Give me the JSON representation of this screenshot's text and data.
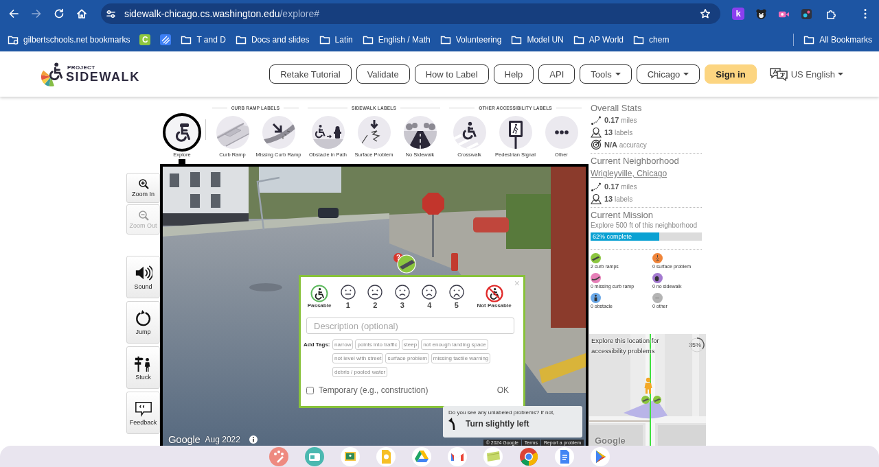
{
  "browser": {
    "forward_disabled": true,
    "url": {
      "host": "sidewalk-chicago.cs.washington.edu",
      "path": "/explore#"
    },
    "extensions": [
      {
        "kind": "letter",
        "label": "k"
      },
      {
        "kind": "bear"
      },
      {
        "kind": "camera"
      },
      {
        "kind": "dots"
      },
      {
        "kind": "puzzle"
      }
    ]
  },
  "bookmarks": {
    "items": [
      {
        "kind": "managed-folder",
        "label": "gilbertschools.net bookmarks"
      },
      {
        "kind": "letter",
        "label": "C"
      },
      {
        "kind": "stripes"
      },
      {
        "kind": "folder",
        "label": "T and D"
      },
      {
        "kind": "folder",
        "label": "Docs and slides"
      },
      {
        "kind": "folder",
        "label": "Latin"
      },
      {
        "kind": "folder",
        "label": "English / Math"
      },
      {
        "kind": "folder",
        "label": "Volunteering"
      },
      {
        "kind": "folder",
        "label": "Model UN"
      },
      {
        "kind": "folder",
        "label": "AP World"
      },
      {
        "kind": "folder",
        "label": "chem"
      }
    ],
    "all": "All Bookmarks"
  },
  "header": {
    "logo": {
      "small": "PROJECT",
      "big": "SIDEWALK"
    },
    "nav": [
      {
        "label": "Retake Tutorial",
        "kind": "outline"
      },
      {
        "label": "Validate",
        "kind": "outline"
      },
      {
        "label": "How to Label",
        "kind": "outline"
      },
      {
        "label": "Help",
        "kind": "outline"
      },
      {
        "label": "API",
        "kind": "outline"
      },
      {
        "label": "Tools",
        "kind": "dropdown"
      },
      {
        "label": "Chicago",
        "kind": "dropdown"
      },
      {
        "label": "Sign in",
        "kind": "primary"
      }
    ],
    "language": "US English"
  },
  "label_toolbar": {
    "explore": {
      "label": "Explore",
      "selected": true
    },
    "groups": [
      {
        "heading": "CURB RAMP LABELS",
        "tools": [
          {
            "kind": "curb-ramp",
            "label": "Curb Ramp",
            "selected": false
          },
          {
            "kind": "missing-curb-ramp",
            "label": "Missing Curb Ramp",
            "selected": false
          }
        ]
      },
      {
        "heading": "SIDEWALK LABELS",
        "tools": [
          {
            "kind": "obstacle",
            "label": "Obstacle in Path",
            "selected": false
          },
          {
            "kind": "surface-problem",
            "label": "Surface Problem",
            "selected": false
          },
          {
            "kind": "no-sidewalk",
            "label": "No Sidewalk",
            "selected": false
          }
        ]
      },
      {
        "heading": "OTHER ACCESSIBILITY LABELS",
        "tools": [
          {
            "kind": "crosswalk",
            "label": "Crosswalk",
            "selected": false
          },
          {
            "kind": "pedestrian-signal",
            "label": "Pedestrian Signal",
            "selected": false
          },
          {
            "kind": "other",
            "label": "Other",
            "selected": false
          }
        ]
      }
    ]
  },
  "left_tools": {
    "zoom": [
      {
        "kind": "zoom-in",
        "label": "Zoom In",
        "disabled": false
      },
      {
        "kind": "zoom-out",
        "label": "Zoom Out",
        "disabled": true
      }
    ],
    "actions": [
      {
        "kind": "sound",
        "label": "Sound"
      },
      {
        "kind": "jump",
        "label": "Jump"
      },
      {
        "kind": "stuck",
        "label": "Stuck"
      },
      {
        "kind": "feedback",
        "label": "Feedback"
      }
    ]
  },
  "street_view": {
    "logo": "Google",
    "date": "Aug 2022",
    "marker": {
      "symbol": "?"
    },
    "popup": {
      "close": "×",
      "severity": [
        {
          "kind": "passable",
          "label": "Passable",
          "selected": false
        },
        {
          "kind": "face",
          "label": "1",
          "selected": false
        },
        {
          "kind": "face",
          "label": "2",
          "selected": false
        },
        {
          "kind": "face",
          "label": "3",
          "selected": false
        },
        {
          "kind": "face",
          "label": "4",
          "selected": false
        },
        {
          "kind": "face",
          "label": "5",
          "selected": false
        },
        {
          "kind": "not-passable",
          "label": "Not Passable",
          "selected": false
        }
      ],
      "description": {
        "placeholder": "Description (optional)"
      },
      "tags_label": "Add Tags:",
      "tags": [
        {
          "label": "narrow",
          "selected": false
        },
        {
          "label": "points into traffic",
          "selected": false
        },
        {
          "label": "steep",
          "selected": false
        },
        {
          "label": "not enough landing space",
          "selected": false
        },
        {
          "label": "not level with street",
          "selected": false
        },
        {
          "label": "surface problem",
          "selected": false
        },
        {
          "label": "missing tactile warning",
          "selected": false
        },
        {
          "label": "debris / pooled water",
          "selected": false
        }
      ],
      "temporary": {
        "label": "Temporary (e.g., construction)",
        "checked": false
      },
      "ok": "OK"
    },
    "navigation": {
      "prompt": "Do you see any unlabeled problems? If not,",
      "action": "Turn slightly left"
    },
    "attribution": [
      "© 2024 Google",
      "Terms",
      "Report a problem"
    ]
  },
  "stats": {
    "overall": {
      "title": "Overall Stats",
      "rows": [
        {
          "kind": "distance",
          "text": "**0.17** miles"
        },
        {
          "kind": "labels",
          "text": "**13** labels"
        },
        {
          "kind": "accuracy",
          "text": "**N/A** accuracy"
        }
      ]
    },
    "neighborhood": {
      "title": "Current Neighborhood",
      "name": "Wrigleyville, Chicago",
      "rows": [
        {
          "kind": "distance",
          "text": "**0.17** miles"
        },
        {
          "kind": "labels",
          "text": "**13** labels"
        }
      ]
    },
    "mission": {
      "title": "Current Mission",
      "description": "Explore 500 ft of this neighborhood",
      "progress": {
        "level": 0.62,
        "text": "62% complete"
      }
    },
    "label_counts": [
      {
        "kind": "curb-ramp",
        "text": "2 curb ramps",
        "color": "#8cc63f"
      },
      {
        "kind": "surface-problem",
        "text": "0 surface problem",
        "color": "#f0853a"
      },
      {
        "kind": "missing-curb-ramp",
        "text": "0 missing curb ramp",
        "color": "#e77fb8"
      },
      {
        "kind": "no-sidewalk",
        "text": "0 no sidewalk",
        "color": "#a47ad0"
      },
      {
        "kind": "obstacle",
        "text": "0 obstacle",
        "color": "#6aa8e8"
      },
      {
        "kind": "other",
        "text": "0 other",
        "color": "#b4b4b4"
      }
    ]
  },
  "minimap": {
    "caption": "Explore this location for accessibility problems",
    "percent": "35%",
    "level": 0.35,
    "logo": "Google"
  },
  "taskbar": [
    {
      "kind": "palette"
    },
    {
      "kind": "card"
    },
    {
      "kind": "board"
    },
    {
      "kind": "bulb"
    },
    {
      "kind": "drive"
    },
    {
      "kind": "mail"
    },
    {
      "kind": "note"
    },
    {
      "kind": "browser"
    },
    {
      "kind": "doc"
    },
    {
      "kind": "play"
    }
  ]
}
